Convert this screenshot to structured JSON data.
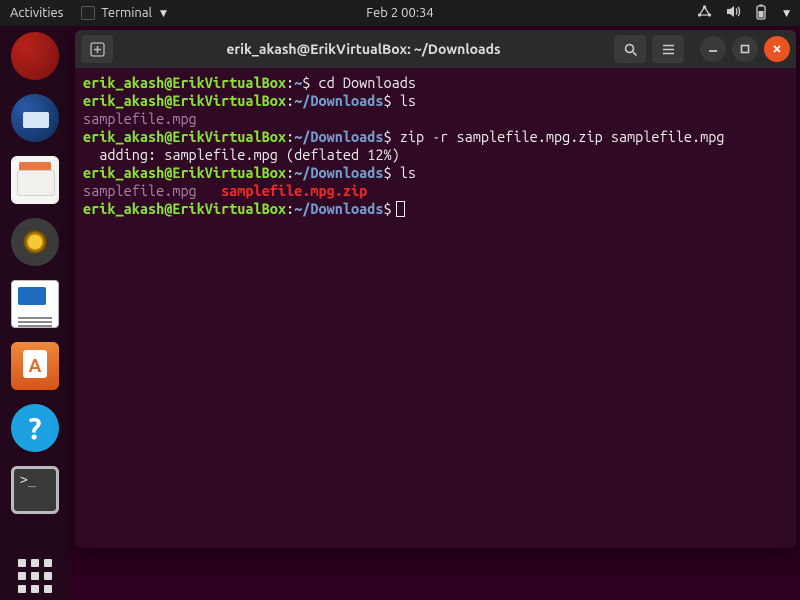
{
  "topbar": {
    "activities": "Activities",
    "terminal_menu": "Terminal",
    "datetime": "Feb 2  00:34"
  },
  "titlebar": {
    "title": "erik_akash@ErikVirtualBox: ~/Downloads"
  },
  "prompt": {
    "userhost": "erik_akash@ErikVirtualBox",
    "colon": ":",
    "dollar": "$",
    "home": "~",
    "downloads": "~/Downloads"
  },
  "lines": {
    "cmd1": " cd Downloads",
    "cmd2": " ls",
    "file1": "samplefile.mpg",
    "cmd3": " zip -r samplefile.mpg.zip samplefile.mpg",
    "zipout": "  adding: samplefile.mpg (deflated 12%)",
    "cmd4": " ls",
    "ls2_a": "samplefile.mpg",
    "ls2_gap": "   ",
    "ls2_b": "samplefile.mpg.zip"
  }
}
